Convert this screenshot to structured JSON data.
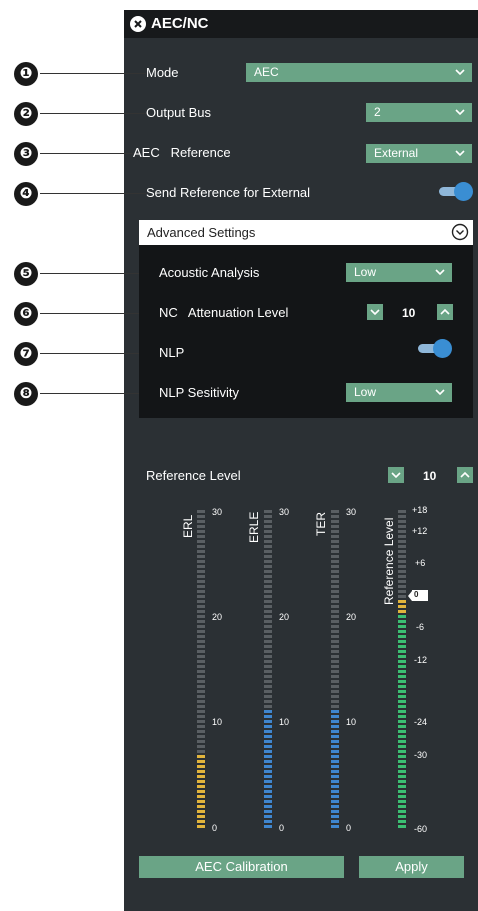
{
  "window": {
    "title": "AEC/NC"
  },
  "callouts": [
    "❶",
    "❷",
    "❸",
    "❹",
    "❺",
    "❻",
    "❼",
    "❽"
  ],
  "settings": {
    "mode": {
      "label": "Mode",
      "value": "AEC"
    },
    "output_bus": {
      "label": "Output Bus",
      "value": "2"
    },
    "aec_reference": {
      "label": "AEC   Reference",
      "value": "External"
    },
    "send_reference": {
      "label": "Send Reference for External",
      "on": true
    }
  },
  "advanced": {
    "title": "Advanced Settings",
    "acoustic_analysis": {
      "label": "Acoustic Analysis",
      "value": "Low"
    },
    "nc_attenuation": {
      "label": "NC   Attenuation Level",
      "value": "10"
    },
    "nlp": {
      "label": "NLP",
      "on": true
    },
    "nlp_sensitivity": {
      "label": "NLP Sesitivity",
      "value": "Low"
    }
  },
  "reference_level": {
    "label": "Reference Level",
    "value": "10"
  },
  "meters": [
    {
      "name": "ERL",
      "ticks": [
        "30",
        "20",
        "10",
        "0"
      ],
      "level": 0.23,
      "color": "#e1b43c"
    },
    {
      "name": "ERLE",
      "ticks": [
        "30",
        "20",
        "10",
        "0"
      ],
      "level": 0.37,
      "color": "#3f86cf"
    },
    {
      "name": "TER",
      "ticks": [
        "30",
        "20",
        "10",
        "0"
      ],
      "level": 0.37,
      "color": "#3f86cf"
    },
    {
      "name": "Reference Level",
      "ticks": [
        "+18",
        "+12",
        "+6",
        "0",
        "-6",
        "-12",
        "-24",
        "-30",
        "-60"
      ],
      "level": 0.72,
      "color": "#3cbf72",
      "top_color": "#e1b43c"
    }
  ],
  "buttons": {
    "calibration": "AEC Calibration",
    "apply": "Apply"
  }
}
